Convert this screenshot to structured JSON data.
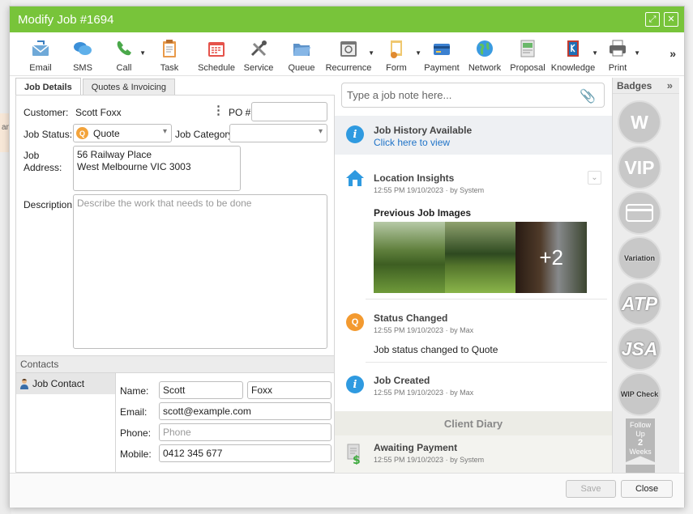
{
  "window": {
    "title": "Modify Job #1694"
  },
  "toolbar": [
    {
      "label": "Email",
      "icon": "email-icon",
      "caret": false
    },
    {
      "label": "SMS",
      "icon": "sms-icon",
      "caret": false
    },
    {
      "label": "Call",
      "icon": "phone-icon",
      "caret": true
    },
    {
      "label": "Task",
      "icon": "clipboard-icon",
      "caret": false
    },
    {
      "label": "Schedule",
      "icon": "calendar-icon",
      "caret": false
    },
    {
      "label": "Service",
      "icon": "tools-icon",
      "caret": false
    },
    {
      "label": "Queue",
      "icon": "folder-icon",
      "caret": false
    },
    {
      "label": "Recurrence",
      "icon": "recurrence-icon",
      "caret": true
    },
    {
      "label": "Form",
      "icon": "form-icon",
      "caret": true
    },
    {
      "label": "Payment",
      "icon": "credit-card-icon",
      "caret": false
    },
    {
      "label": "Network",
      "icon": "network-icon",
      "caret": false
    },
    {
      "label": "Proposal",
      "icon": "proposal-icon",
      "caret": false
    },
    {
      "label": "Knowledge",
      "icon": "book-icon",
      "caret": true
    },
    {
      "label": "Print",
      "icon": "printer-icon",
      "caret": true
    }
  ],
  "tabs": [
    "Job Details",
    "Quotes & Invoicing"
  ],
  "form": {
    "customer_label": "Customer:",
    "customer": "Scott Foxx",
    "po_label": "PO #",
    "status_label": "Job Status:",
    "status": "Quote",
    "status_badge": "Q",
    "category_label": "Job Category",
    "address_label_1": "Job",
    "address_label_2": "Address:",
    "address_line1": "56 Railway Place",
    "address_line2": "West Melbourne VIC 3003",
    "description_label": "Description:",
    "description_placeholder": "Describe the work that needs to be done"
  },
  "contacts": {
    "header": "Contacts",
    "item": "Job Contact",
    "name_label": "Name:",
    "first_name": "Scott",
    "last_name": "Foxx",
    "email_label": "Email:",
    "email": "scott@example.com",
    "phone_label": "Phone:",
    "phone_placeholder": "Phone",
    "mobile_label": "Mobile:",
    "mobile": "0412 345 677"
  },
  "notes": {
    "placeholder": "Type a job note here..."
  },
  "feed": {
    "history_title": "Job History Available",
    "history_link": "Click here to view",
    "insights_title": "Location Insights",
    "insights_meta": "12:55 PM 19/10/2023  ·  by System",
    "images_title": "Previous Job Images",
    "images_more": "+2",
    "status_title": "Status Changed",
    "status_meta": "12:55 PM 19/10/2023  ·  by Max",
    "status_body": "Job status changed to Quote",
    "created_title": "Job Created",
    "created_meta": "12:55 PM 19/10/2023  ·  by Max",
    "diary_header": "Client Diary",
    "payment_title": "Awaiting Payment",
    "payment_meta": "12:55 PM 19/10/2023  ·  by System"
  },
  "badges": {
    "header": "Badges",
    "items": [
      "W",
      "VIP",
      "",
      "Variation",
      "ATP",
      "JSA",
      "WIP Check"
    ],
    "ribbon_top": "Follow Up",
    "ribbon_mid": "2",
    "ribbon_bottom": "Weeks"
  },
  "footer": {
    "save": "Save",
    "close": "Close"
  },
  "background": {
    "fragment": "am"
  },
  "colors": {
    "titlebar": "#78c43a",
    "info": "#2f9ae0",
    "quote": "#f39a30",
    "link": "#1f73c8"
  }
}
